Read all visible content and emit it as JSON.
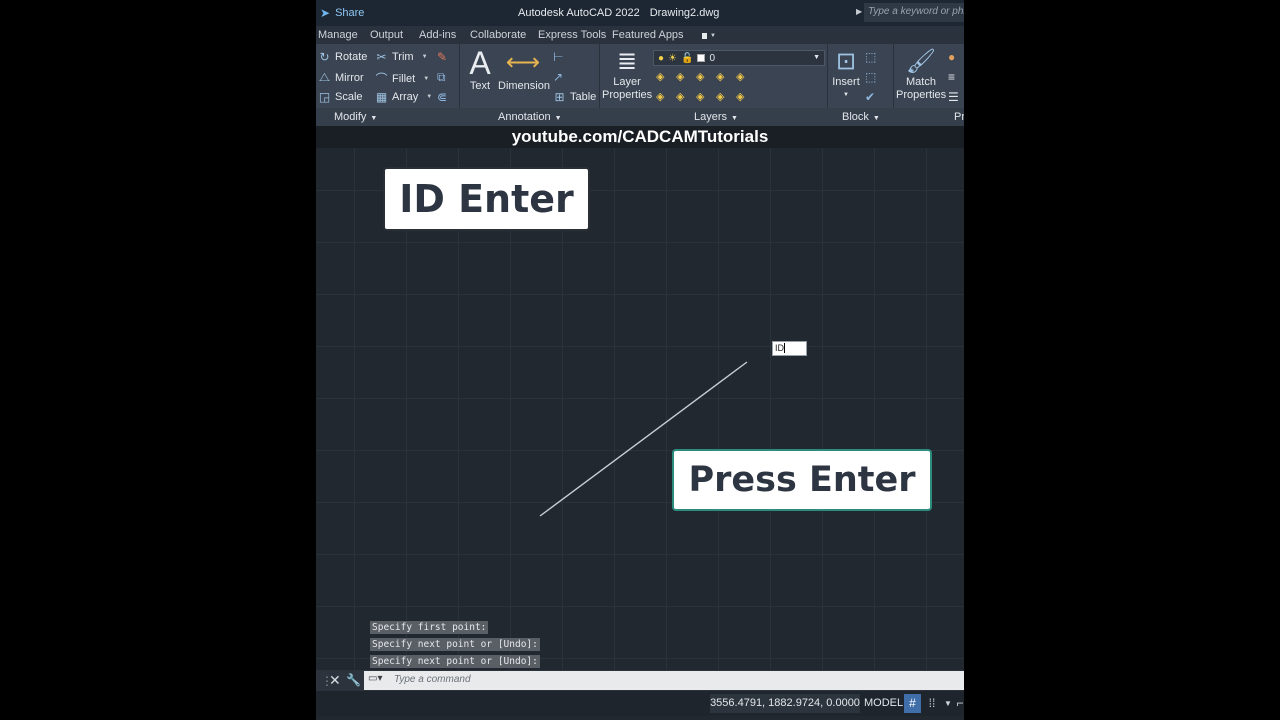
{
  "titlebar": {
    "share_label": "Share",
    "app_title": "Autodesk AutoCAD 2022",
    "document_name": "Drawing2.dwg",
    "search_placeholder": "Type a keyword or phrase"
  },
  "ribbon_tabs": [
    "Manage",
    "Output",
    "Add-ins",
    "Collaborate",
    "Express Tools",
    "Featured Apps"
  ],
  "ribbon": {
    "modify": {
      "title": "Modify",
      "buttons": [
        "Rotate",
        "Mirror",
        "Scale",
        "Trim",
        "Fillet",
        "Array"
      ]
    },
    "annotation": {
      "title": "Annotation",
      "text_label": "Text",
      "dimension_label": "Dimension",
      "table_label": "Table"
    },
    "layers": {
      "title": "Layers",
      "layer_properties_line1": "Layer",
      "layer_properties_line2": "Properties",
      "current_layer": "0"
    },
    "block": {
      "title": "Block",
      "insert_label": "Insert"
    },
    "properties": {
      "title_partial": "Pr",
      "match_line1": "Match",
      "match_line2": "Properties"
    }
  },
  "banner_url": "youtube.com/CADCAMTutorials",
  "callouts": {
    "top": "ID Enter",
    "bottom": "Press Enter"
  },
  "dynamic_input_value": "ID",
  "command_history": [
    "Specify first point:",
    "Specify next point or [Undo]:",
    "Specify next point or [Undo]:"
  ],
  "command_placeholder": "Type a command",
  "status": {
    "coordinates": "3556.4791, 1882.9724, 0.0000",
    "space": "MODEL"
  },
  "colors": {
    "canvas": "#212830",
    "ribbon": "#3b4452",
    "callout_accent": "#2d8b7e",
    "grid_toggle_active": "#3f6ea8"
  }
}
